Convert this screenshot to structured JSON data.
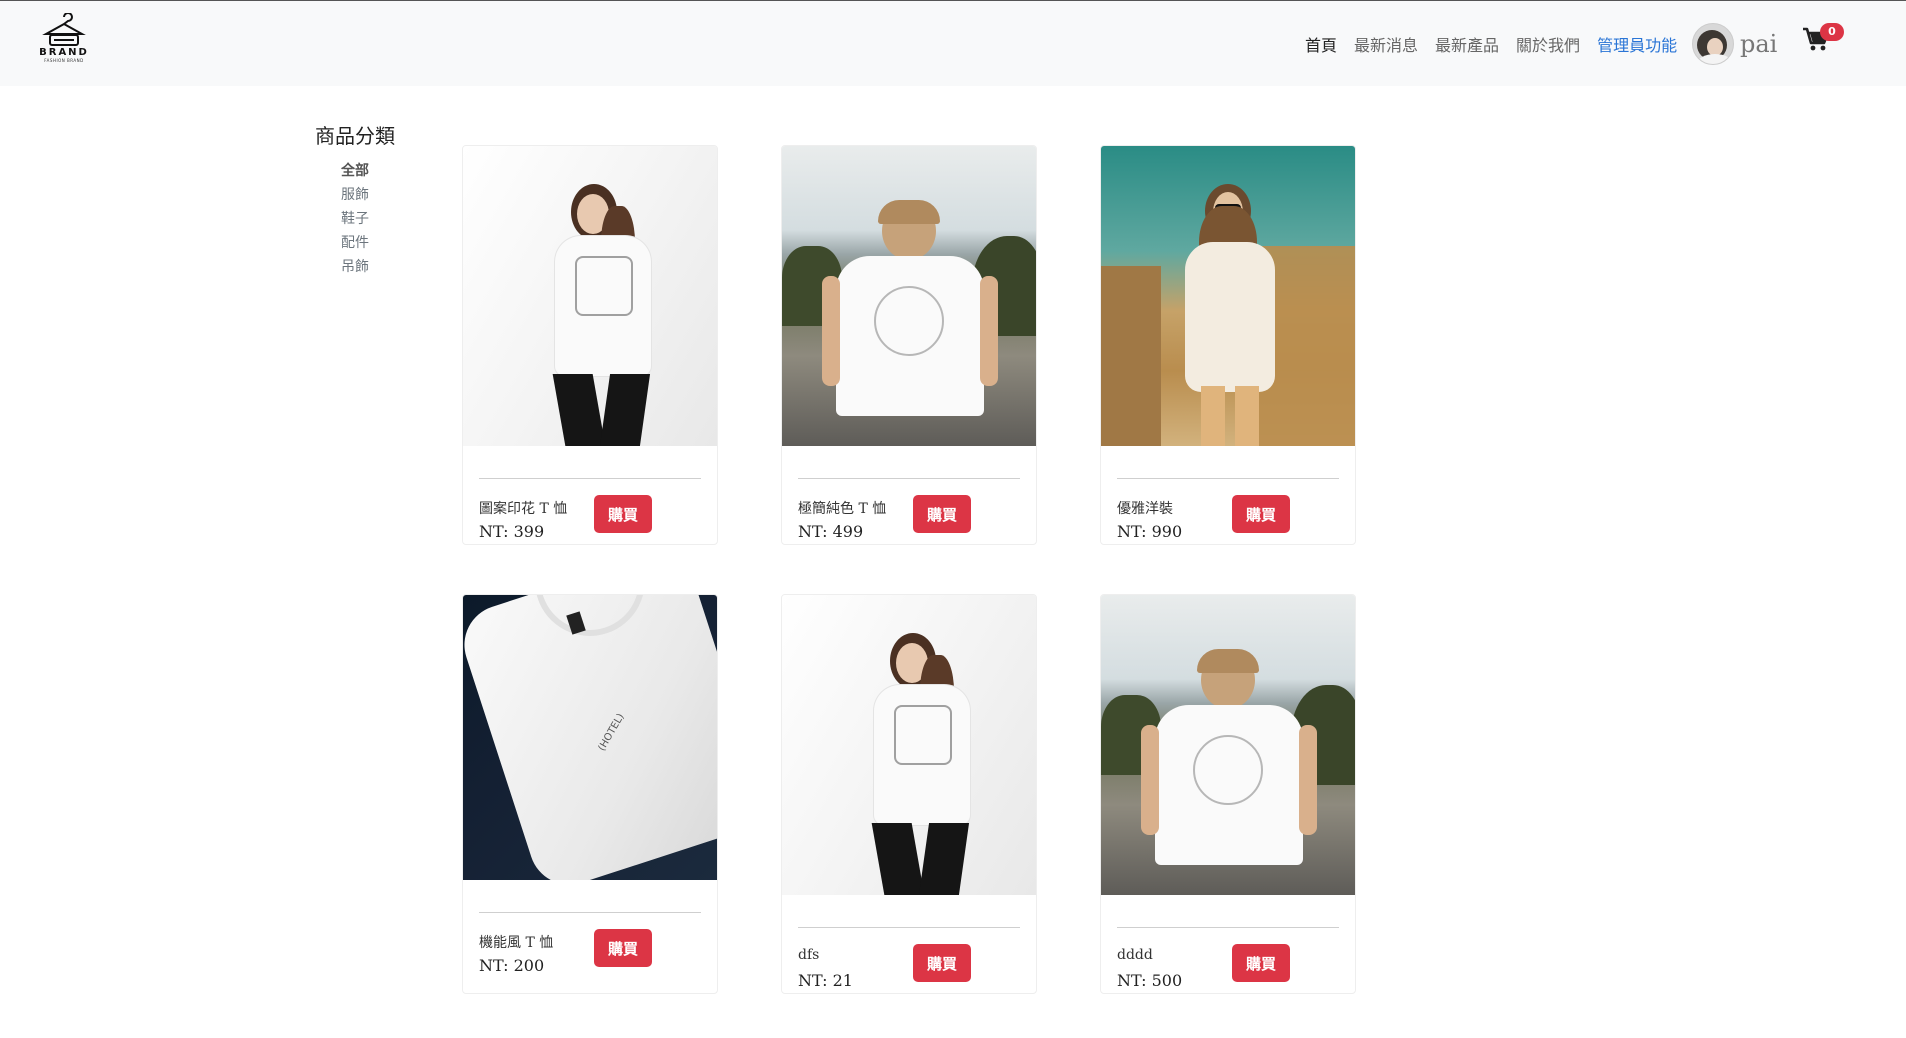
{
  "brand": {
    "name": "BRAND",
    "tagline": "FASHION BRAND"
  },
  "nav": {
    "links": [
      "首頁",
      "最新消息",
      "最新產品",
      "關於我們",
      "管理員功能"
    ],
    "username": "pai",
    "cart_count": "0"
  },
  "sidebar": {
    "title": "商品分類",
    "categories": [
      "全部",
      "服飾",
      "鞋子",
      "配件",
      "吊飾"
    ]
  },
  "products": [
    {
      "name": "圖案印花 T 恤",
      "price": "NT: 399",
      "buy": "購買",
      "image": "woman-graphic-tee"
    },
    {
      "name": "極簡純色 T 恤",
      "price": "NT: 499",
      "buy": "購買",
      "image": "man-back-tee"
    },
    {
      "name": "優雅洋裝",
      "price": "NT: 990",
      "buy": "購買",
      "image": "woman-white-dress"
    },
    {
      "name": "機能風 T 恤",
      "price": "NT: 200",
      "buy": "購買",
      "image": "white-tee-flat"
    },
    {
      "name": "dfs",
      "price": "NT: 21",
      "buy": "購買",
      "image": "woman-graphic-tee"
    },
    {
      "name": "dddd",
      "price": "NT: 500",
      "buy": "購買",
      "image": "man-back-tee"
    }
  ],
  "colors": {
    "accent": "#dc3545",
    "admin_link": "#2a75d6",
    "navbar_bg": "#f8f9fa"
  }
}
